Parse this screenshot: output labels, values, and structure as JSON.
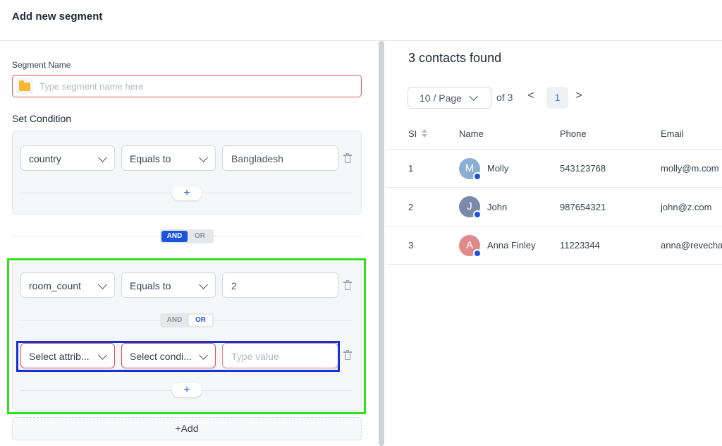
{
  "header": {
    "title": "Add new segment"
  },
  "segment": {
    "name_label": "Segment Name",
    "name_placeholder": "Type segment name here",
    "set_condition_label": "Set Condition"
  },
  "group1": {
    "attribute": "country",
    "condition": "Equals to",
    "value": "Bangladesh",
    "add_symbol": "+"
  },
  "group_toggle": {
    "and": "AND",
    "or": "OR",
    "selected": "AND"
  },
  "group2": {
    "row1": {
      "attribute": "room_count",
      "condition": "Equals to",
      "value": "2"
    },
    "toggle": {
      "and": "AND",
      "or": "OR",
      "selected": "OR"
    },
    "row2": {
      "attribute_placeholder": "Select attrib...",
      "condition_placeholder": "Select condi...",
      "value_placeholder": "Type value"
    },
    "add_symbol": "+"
  },
  "add_button": "+Add",
  "results": {
    "found": "3 contacts found",
    "page_size": "10 / Page",
    "of_pages": "of 3",
    "prev": "<",
    "next": ">",
    "current_page": "1",
    "columns": {
      "sl": "SI",
      "name": "Name",
      "phone": "Phone",
      "email": "Email"
    },
    "rows": [
      {
        "sl": "1",
        "initial": "M",
        "name": "Molly",
        "phone": "543123768",
        "email": "molly@m.com",
        "avatar_color": "#8aaed4"
      },
      {
        "sl": "2",
        "initial": "J",
        "name": "John",
        "phone": "987654321",
        "email": "john@z.com",
        "avatar_color": "#7a8aa8"
      },
      {
        "sl": "3",
        "initial": "A",
        "name": "Anna Finley",
        "phone": "11223344",
        "email": "anna@revecha",
        "avatar_color": "#e08a8a"
      }
    ]
  },
  "colors": {
    "accent": "#1a56db",
    "error": "#e05a4f",
    "highlight_green": "#2ee21b",
    "highlight_blue": "#1433d6"
  }
}
